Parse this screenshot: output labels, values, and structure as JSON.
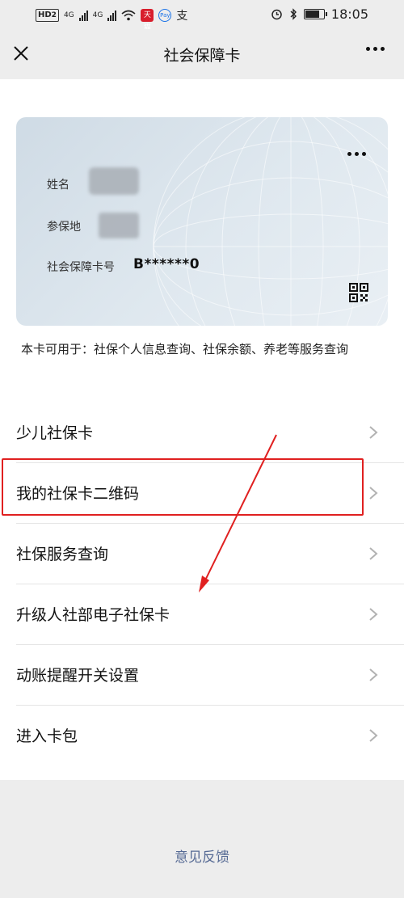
{
  "status_bar": {
    "hd": "HD",
    "hd_sub": "2",
    "net1": "4G",
    "net2": "4G",
    "app_badge": "天猫",
    "pay": "Pay",
    "alipay": "支",
    "time": "18:05"
  },
  "nav": {
    "title": "社会保障卡"
  },
  "card": {
    "name_label": "姓名",
    "location_label": "参保地",
    "number_label": "社会保障卡号",
    "number_value": "B******0"
  },
  "card_description": "本卡可用于：社保个人信息查询、社保余额、养老等服务查询",
  "menu": {
    "items": [
      {
        "label": "少儿社保卡"
      },
      {
        "label": "我的社保卡二维码"
      },
      {
        "label": "社保服务查询"
      },
      {
        "label": "升级人社部电子社保卡"
      },
      {
        "label": "动账提醒开关设置"
      },
      {
        "label": "进入卡包"
      }
    ]
  },
  "footer": {
    "feedback": "意见反馈"
  },
  "colors": {
    "background": "#ededed",
    "highlight": "#e02020",
    "link": "#576b95"
  }
}
